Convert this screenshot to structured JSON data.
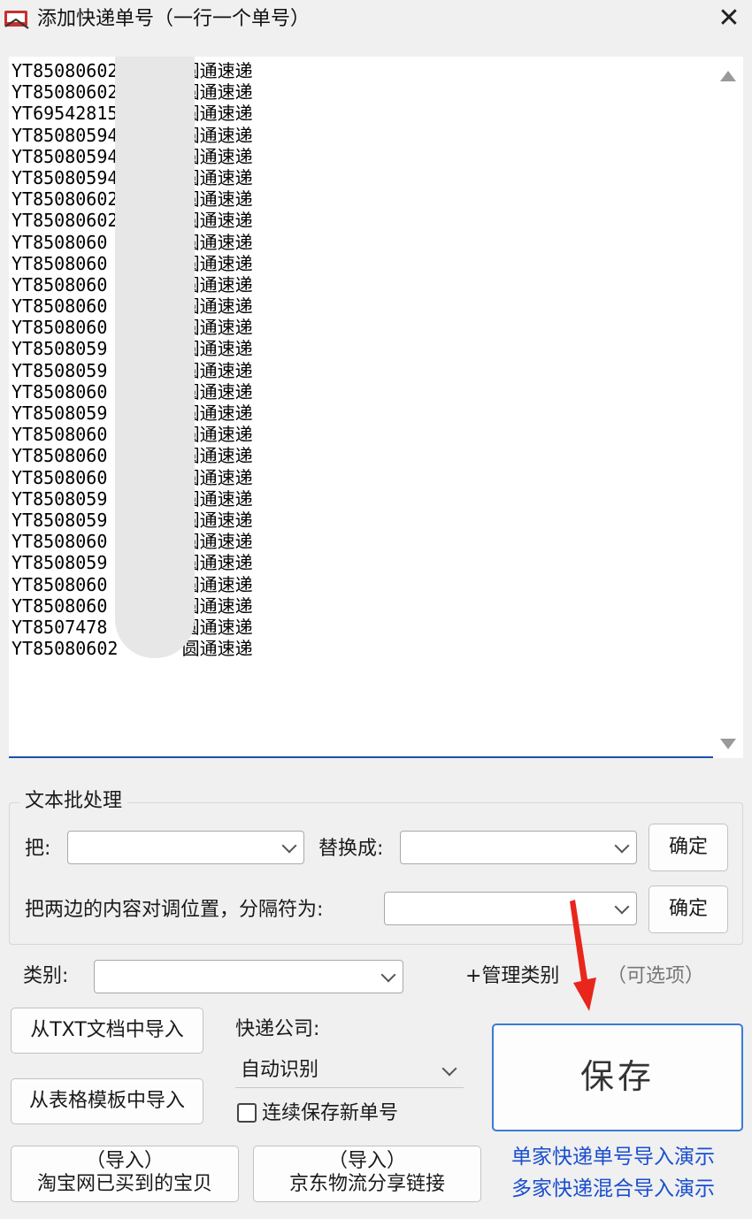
{
  "window": {
    "title": "添加快递单号（一行一个单号）",
    "close_symbol": "✕",
    "icon": "app-icon"
  },
  "tracking_list": [
    "YT850806020",
    "YT850806022",
    "YT695428158",
    "YT850805948",
    "YT850805948",
    "YT850805945",
    "YT85080602",
    "YT85080602",
    "YT8508060",
    "YT8508060",
    "YT8508060",
    "YT8508060",
    "YT8508060",
    "YT8508059",
    "YT8508059",
    "YT8508060",
    "YT8508059",
    "YT8508060",
    "YT8508060",
    "YT8508060",
    "YT8508059",
    "YT8508059",
    "YT8508060",
    "YT8508059",
    "YT8508060",
    "YT8508060",
    "YT8507478",
    "YT85080602"
  ],
  "courier_suffix": "圆通速递",
  "batch": {
    "group_title": "文本批处理",
    "replace_from_label": "把:",
    "replace_to_label": "替换成:",
    "confirm_label": "确定",
    "swap_label": "把两边的内容对调位置，分隔符为:"
  },
  "category": {
    "label": "类别:",
    "manage_label": "+管理类别",
    "optional_hint": "（可选项）"
  },
  "courier_company": {
    "label": "快递公司:",
    "value": "自动识别"
  },
  "continuous_save": {
    "label": "连续保存新单号",
    "checked": false
  },
  "buttons": {
    "import_txt": "从TXT文档中导入",
    "import_template": "从表格模板中导入",
    "import_taobao_top": "（导入）",
    "import_taobao_bottom": "淘宝网已买到的宝贝",
    "import_jd_top": "（导入）",
    "import_jd_bottom": "京东物流分享链接",
    "save": "保存"
  },
  "links": {
    "single_demo": "单家快递单号导入演示",
    "multi_demo": "多家快递混合导入演示"
  },
  "colors": {
    "accent": "#3a7bd5",
    "link": "#1a4fd0",
    "annotation_arrow": "#e8261c"
  }
}
